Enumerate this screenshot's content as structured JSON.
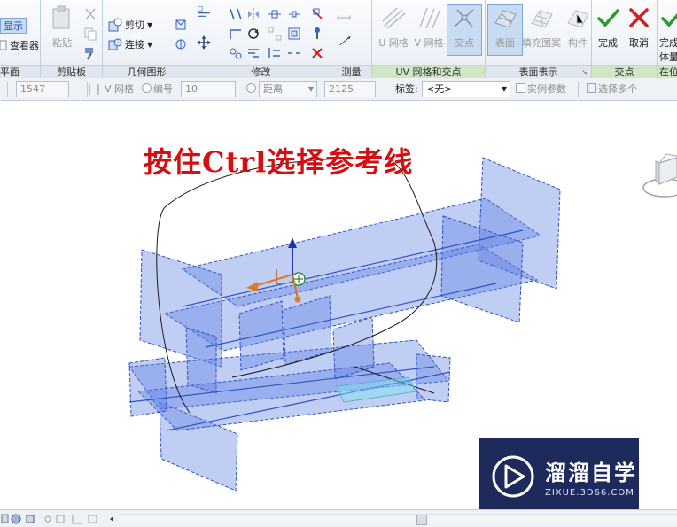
{
  "ribbon": {
    "panels": {
      "plane": "平面",
      "clipboard": "剪贴板",
      "geometry": "几何图形",
      "modify": "修改",
      "measure": "测量",
      "uv_grid": "UV 网格和交点",
      "surface": "表面表示",
      "intersect": "交点",
      "inplace": "在位"
    },
    "buttons": {
      "show": "显示",
      "viewer": "查看器",
      "paste": "粘贴",
      "cut": "剪切",
      "join": "连接",
      "u_grid": "U 网格",
      "v_grid": "V 网格",
      "intersect": "交点",
      "surface": "表面",
      "fill_pattern": "填充图案",
      "component": "构件",
      "finish": "完成",
      "cancel": "取消",
      "finish_body_line1": "完成",
      "finish_body_line2": "体量"
    }
  },
  "optbar": {
    "field1": "1547",
    "v_grid_label": "V 网格",
    "number_label": "编号",
    "number_value": "10",
    "distance_label": "距离",
    "distance_value": "2125",
    "tag_label": "标签:",
    "tag_value": "<无>",
    "instance_param": "实例参数",
    "select_multiple": "选择多个"
  },
  "canvas": {
    "caption": "按住Ctrl选择参考线"
  },
  "watermark": {
    "name": "溜溜自学",
    "url": "ZIXUE.3D66.COM"
  },
  "colors": {
    "plane_fill": "#5b7fe3",
    "plane_stroke": "#2f53c4",
    "caption": "#d40f14",
    "watermark_bg": "#1d2a5b",
    "finish_check": "#2e9a2e",
    "cancel_x": "#d02020"
  }
}
